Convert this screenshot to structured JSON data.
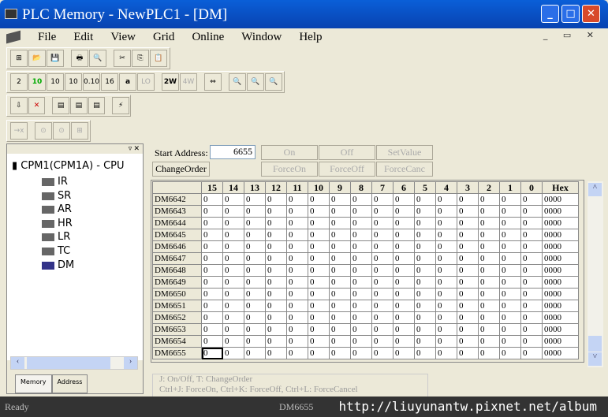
{
  "window": {
    "title": "PLC Memory - NewPLC1 - [DM]",
    "minimize": "_",
    "maximize": "□",
    "close": "✕"
  },
  "menu": [
    "File",
    "Edit",
    "View",
    "Grid",
    "Online",
    "Window",
    "Help"
  ],
  "mdi_controls": "_ ▭ ✕",
  "toolbar": {
    "row1": [
      "⊞",
      "📂",
      "💾",
      "🖶",
      "🔍",
      "✂",
      "⎘",
      "📋"
    ],
    "row2": [
      "2",
      "10",
      "10",
      "10",
      "0.10",
      "16",
      "a",
      "LO",
      "2W",
      "4W",
      "⇔",
      "🔍",
      "🔍",
      "🔍"
    ],
    "row3": [
      "⇩",
      "✕",
      "▤",
      "▤",
      "▤",
      "⚡"
    ],
    "row4": [
      "→x",
      "⊙",
      "⊙",
      "⊞"
    ]
  },
  "tree": {
    "root": "CPM1(CPM1A) - CPU",
    "items": [
      "IR",
      "SR",
      "AR",
      "HR",
      "LR",
      "TC",
      "DM"
    ]
  },
  "tabs": [
    "Memory",
    "Address"
  ],
  "controls": {
    "start_address_label": "Start Address:",
    "start_address": "6655",
    "on": "On",
    "off": "Off",
    "set_value": "SetValue",
    "change_order": "ChangeOrder",
    "force_on": "ForceOn",
    "force_off": "ForceOff",
    "force_cancel": "ForceCanc"
  },
  "grid": {
    "headers": [
      "15",
      "14",
      "13",
      "12",
      "11",
      "10",
      "9",
      "8",
      "7",
      "6",
      "5",
      "4",
      "3",
      "2",
      "1",
      "0",
      "Hex"
    ],
    "rows": [
      {
        "addr": "DM6642",
        "bits": "0000000000000000",
        "hex": "0000"
      },
      {
        "addr": "DM6643",
        "bits": "0000000000000000",
        "hex": "0000"
      },
      {
        "addr": "DM6644",
        "bits": "0000000000000000",
        "hex": "0000"
      },
      {
        "addr": "DM6645",
        "bits": "0000000000000000",
        "hex": "0000"
      },
      {
        "addr": "DM6646",
        "bits": "0000000000000000",
        "hex": "0000"
      },
      {
        "addr": "DM6647",
        "bits": "0000000000000000",
        "hex": "0000"
      },
      {
        "addr": "DM6648",
        "bits": "0000000000000000",
        "hex": "0000"
      },
      {
        "addr": "DM6649",
        "bits": "0000000000000000",
        "hex": "0000"
      },
      {
        "addr": "DM6650",
        "bits": "0000000000000000",
        "hex": "0000"
      },
      {
        "addr": "DM6651",
        "bits": "0000000000000000",
        "hex": "0000"
      },
      {
        "addr": "DM6652",
        "bits": "0000000000000000",
        "hex": "0000"
      },
      {
        "addr": "DM6653",
        "bits": "0000000000000000",
        "hex": "0000"
      },
      {
        "addr": "DM6654",
        "bits": "0000000000000000",
        "hex": "0000"
      },
      {
        "addr": "DM6655",
        "bits": "0000000000000000",
        "hex": "0000"
      }
    ]
  },
  "help": {
    "line1": "J: On/Off,    T: ChangeOrder",
    "line2": "Ctrl+J: ForceOn,    Ctrl+K: ForceOff,    Ctrl+L: ForceCancel"
  },
  "status": {
    "text": "Ready",
    "address": "DM6655",
    "watermark": "http://liuyunantw.pixnet.net/album"
  }
}
